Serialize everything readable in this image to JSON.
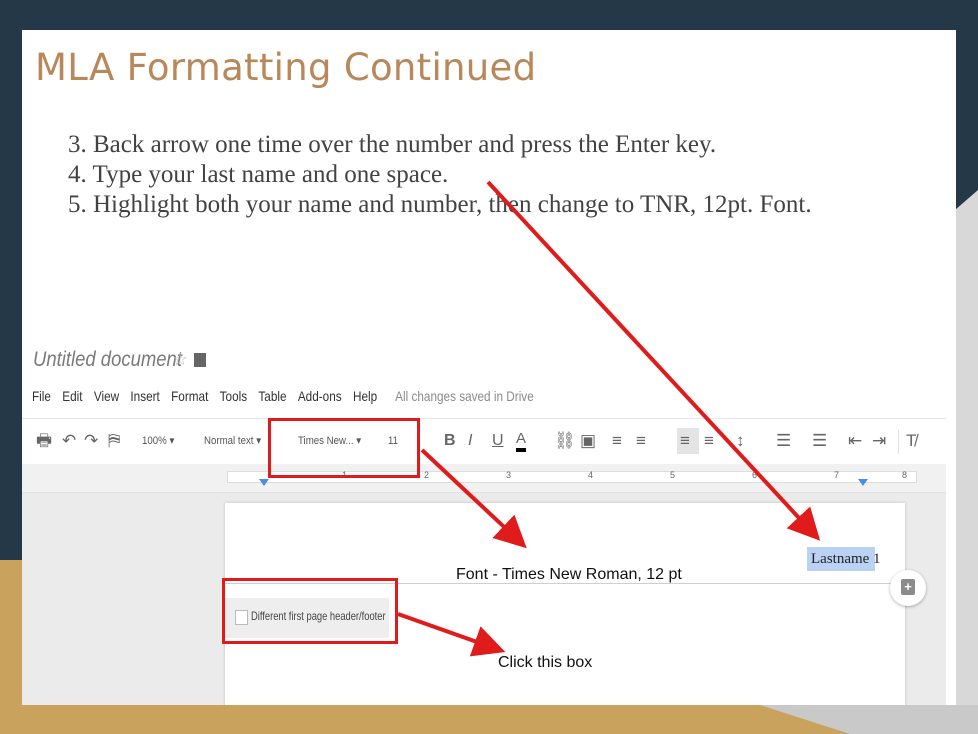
{
  "slide": {
    "title": "MLA Formatting Continued",
    "steps": [
      "3. Back arrow one time over the number and press the Enter key.",
      "4. Type your last name and one space.",
      "5. Highlight both your name and number, then change to TNR, 12pt. Font."
    ]
  },
  "gdoc": {
    "doc_title": "Untitled document",
    "menu": [
      "File",
      "Edit",
      "View",
      "Insert",
      "Format",
      "Tools",
      "Table",
      "Add-ons",
      "Help"
    ],
    "saved_status": "All changes saved in Drive",
    "toolbar": {
      "zoom": "100%",
      "style": "Normal text",
      "font": "Times New...",
      "font_size": "11"
    },
    "ruler_numbers": [
      "1",
      "2",
      "3",
      "4",
      "5",
      "6",
      "7",
      "8"
    ],
    "header_text": "Lastname 1",
    "checkbox_label": "Different first page header/footer"
  },
  "annotations": {
    "font_note": "Font - Times New Roman, 12 pt",
    "box_note": "Click this box"
  },
  "colors": {
    "title": "#b8875a",
    "arrow": "#e01b1b",
    "background_dark": "#243847",
    "background_gold": "#c9a35d"
  }
}
